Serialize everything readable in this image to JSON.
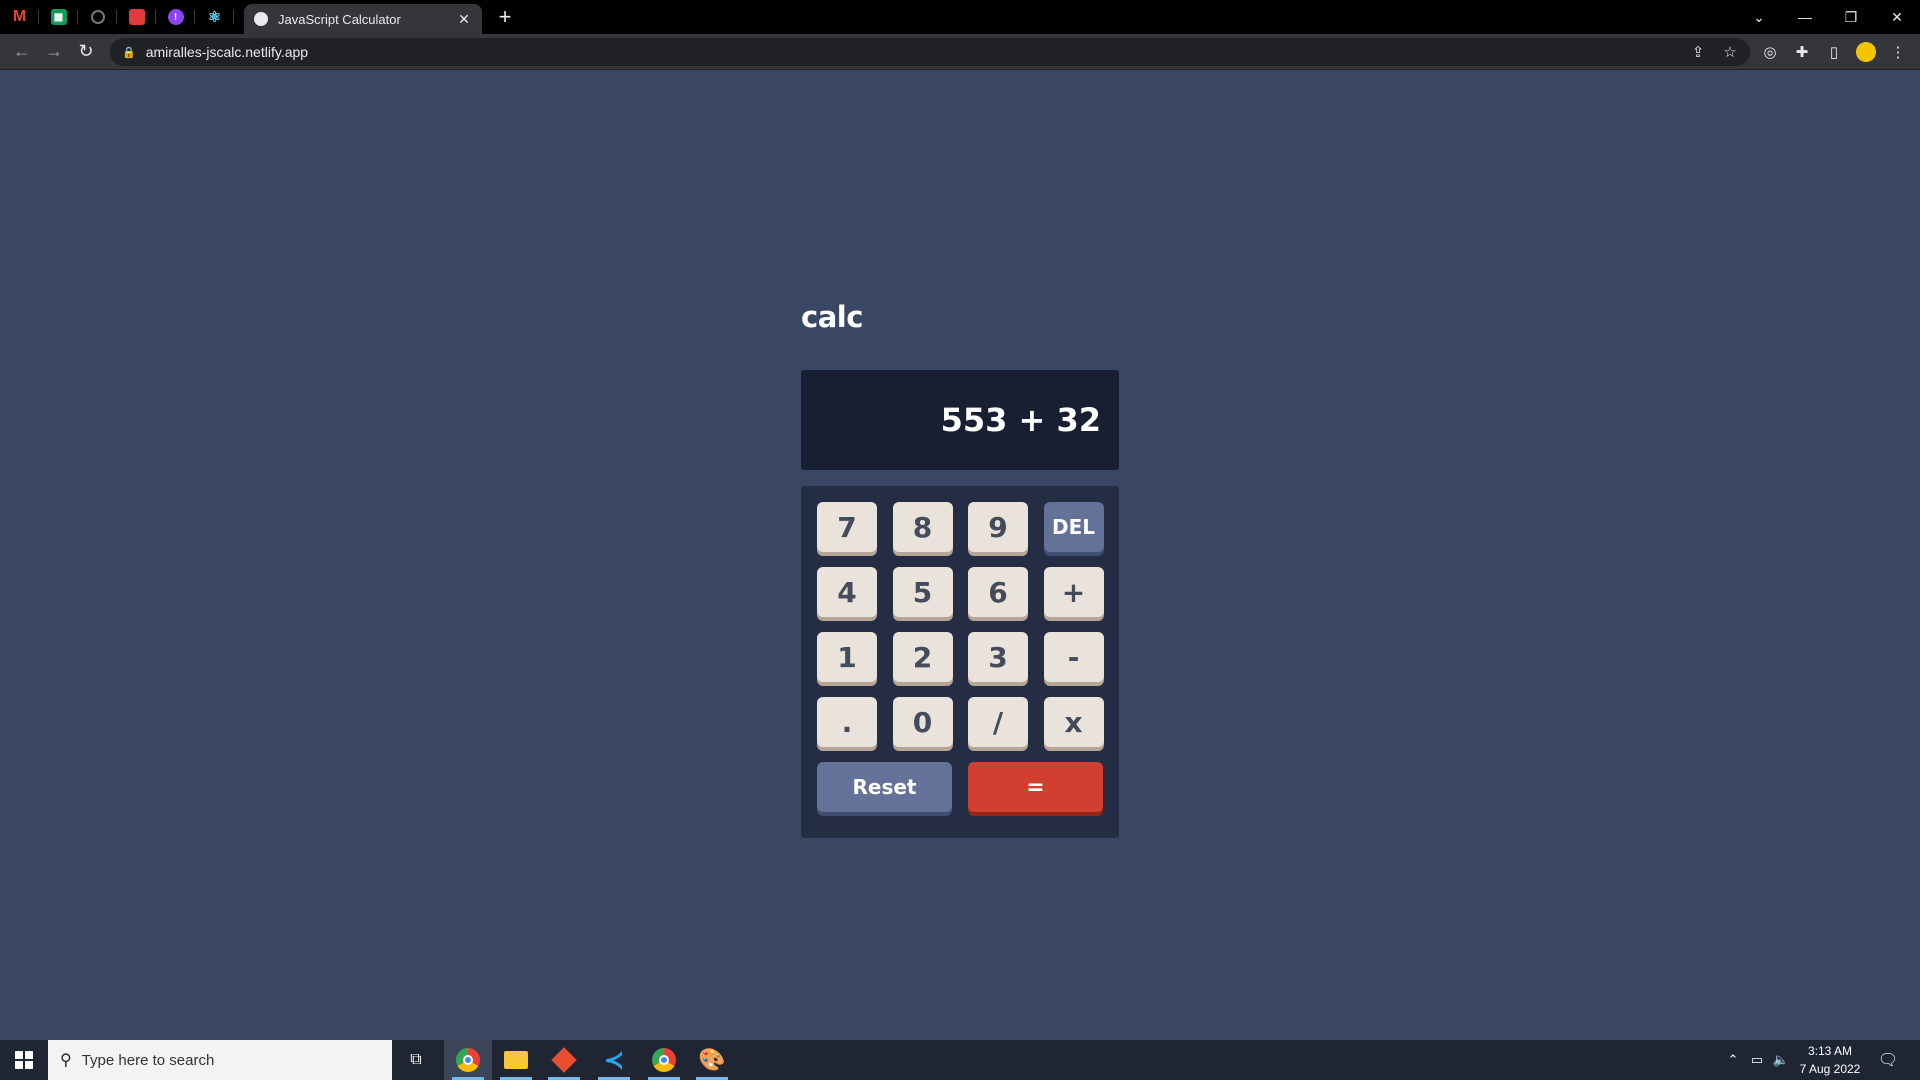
{
  "browser": {
    "pinned_tabs": [
      {
        "icon": "gmail-icon",
        "color": "#ea4335"
      },
      {
        "icon": "sheets-icon",
        "color": "#0f9d58"
      },
      {
        "icon": "github-icon",
        "color": "#888888"
      },
      {
        "icon": "pinned-app-icon",
        "color": "#e03a3a"
      },
      {
        "icon": "pinned-purple-icon",
        "color": "#8e44ec"
      },
      {
        "icon": "react-icon",
        "color": "#61dafb"
      }
    ],
    "active_tab": {
      "title": "JavaScript Calculator",
      "icon": "globe-icon"
    },
    "url": "amiralles-jscalc.netlify.app"
  },
  "calculator": {
    "title": "calc",
    "display": "553 + 32",
    "keys": [
      {
        "label": "7",
        "style": "num"
      },
      {
        "label": "8",
        "style": "num"
      },
      {
        "label": "9",
        "style": "num"
      },
      {
        "label": "DEL",
        "style": "blue"
      },
      {
        "label": "4",
        "style": "num"
      },
      {
        "label": "5",
        "style": "num"
      },
      {
        "label": "6",
        "style": "num"
      },
      {
        "label": "+",
        "style": "num"
      },
      {
        "label": "1",
        "style": "num"
      },
      {
        "label": "2",
        "style": "num"
      },
      {
        "label": "3",
        "style": "num"
      },
      {
        "label": "-",
        "style": "num"
      },
      {
        "label": ".",
        "style": "num"
      },
      {
        "label": "0",
        "style": "num"
      },
      {
        "label": "/",
        "style": "num"
      },
      {
        "label": "x",
        "style": "num"
      }
    ],
    "reset_label": "Reset",
    "equals_label": "="
  },
  "taskbar": {
    "search_placeholder": "Type here to search",
    "time": "3:13 AM",
    "date": "7 Aug 2022",
    "accent": "#76b9ed"
  }
}
